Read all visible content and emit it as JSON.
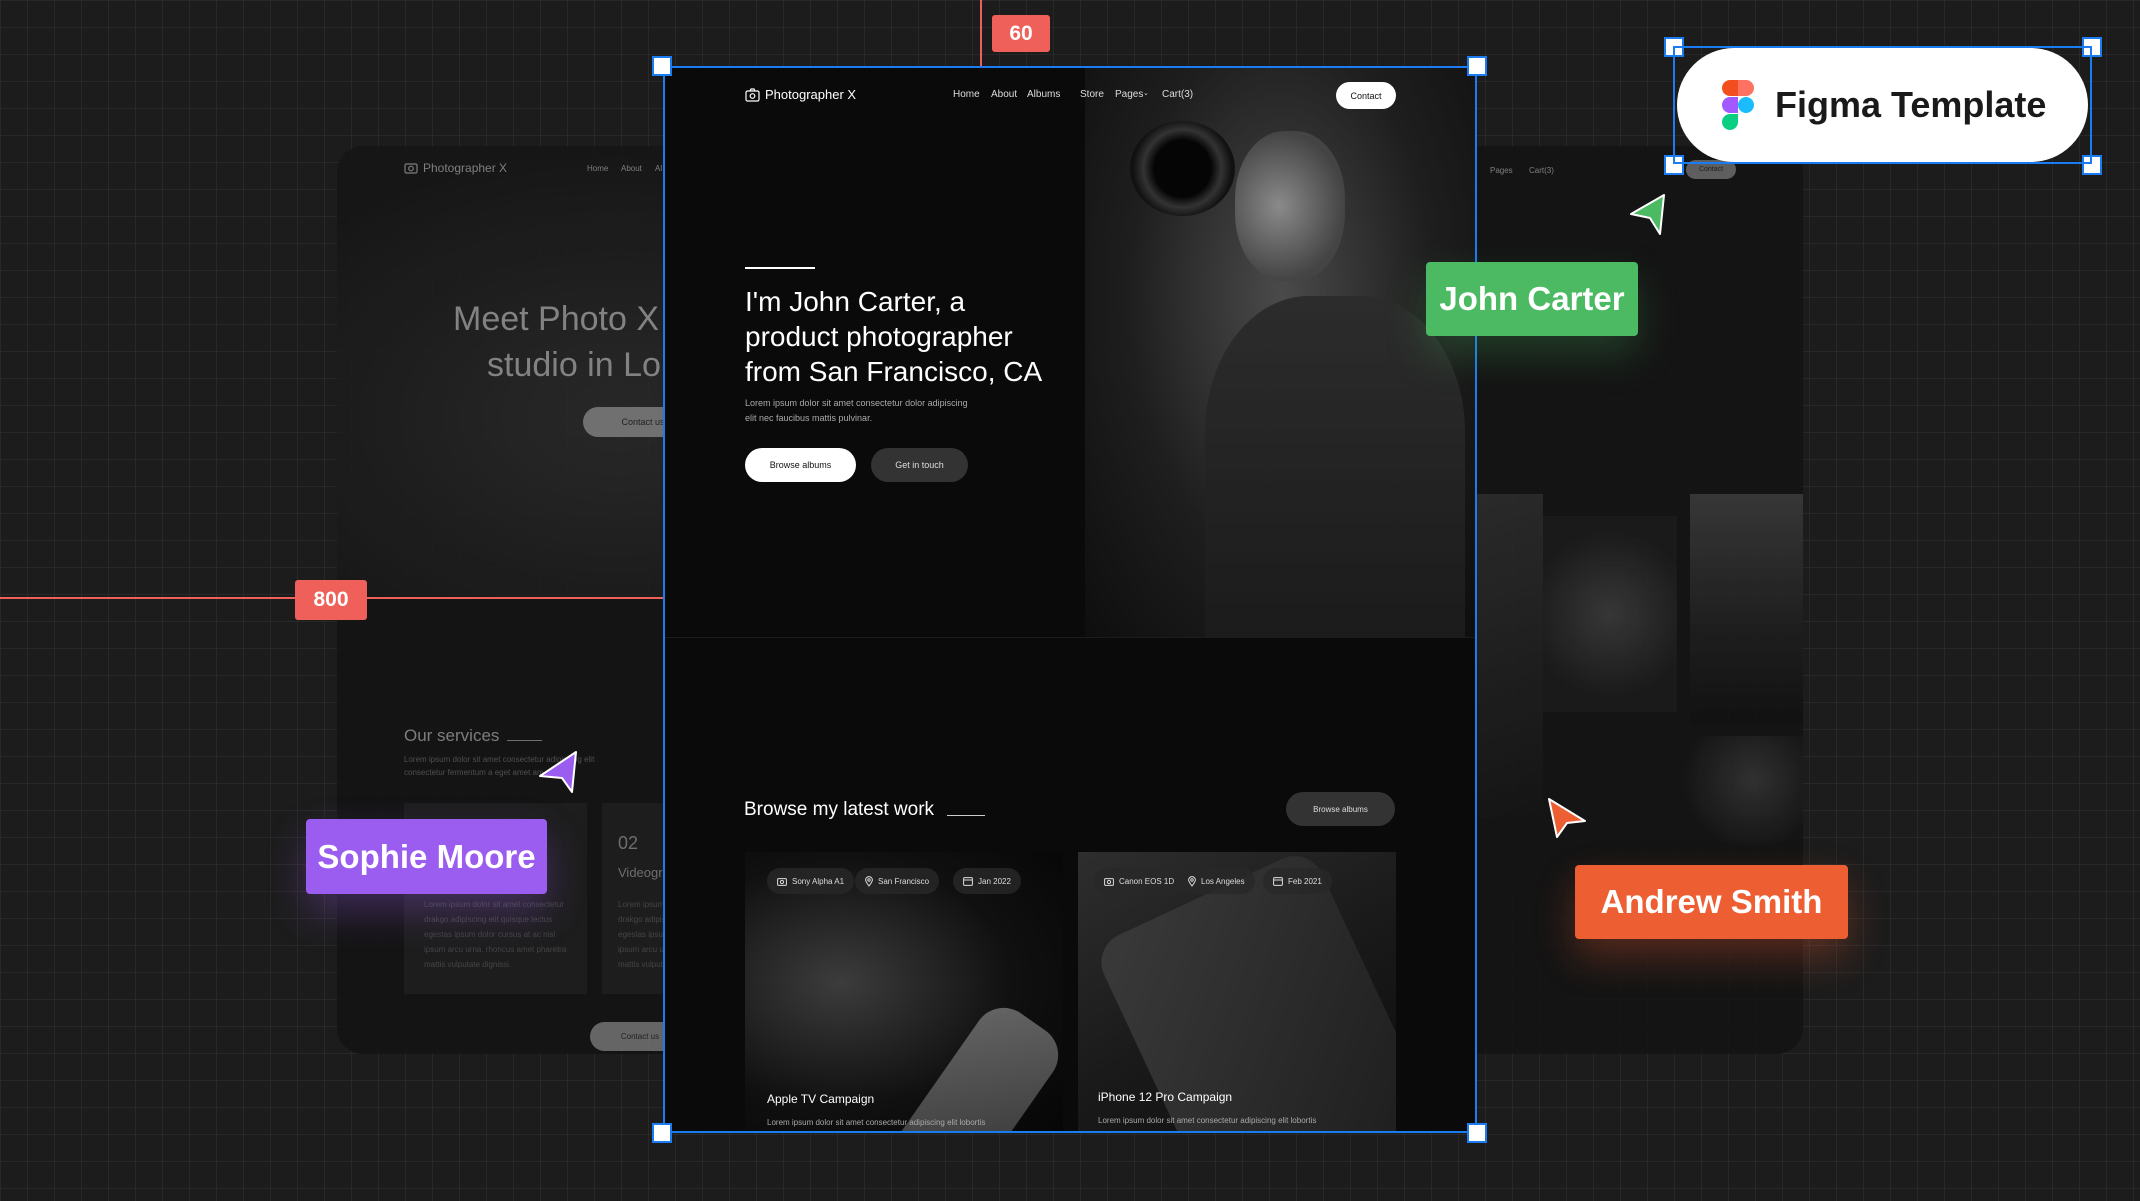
{
  "colors": {
    "selection": "#1a7cf0",
    "ruler": "#f0605a",
    "john": "#4cb963",
    "sophie": "#9b5cf0",
    "andrew": "#ee5e33"
  },
  "rulers": {
    "top": "60",
    "left": "800"
  },
  "badge": {
    "label": "Figma Template",
    "icon": "figma-logo-icon"
  },
  "collaborators": [
    {
      "name": "John Carter"
    },
    {
      "name": "Sophie Moore"
    },
    {
      "name": "Andrew Smith"
    }
  ],
  "left_frame": {
    "brand": "Photographer X",
    "nav": [
      "Home",
      "About",
      "Al"
    ],
    "heading_line1": "Meet Photo X",
    "heading_line2": "studio in Lo",
    "contact": "Contact us",
    "services_title": "Our services",
    "services_text1": "Lorem ipsum dolor sit amet consectetur adipiscing elit",
    "services_text2": "consectetur fermentum a eget amet am",
    "card1_text": [
      "Lorem ipsum dolor sit amet consectetur",
      "drakgo adipiscing elit quisque lectus",
      "egestas ipsum dolor cursus at ac nisl",
      "ipsum arcu urna, rhoncus amet pharetra",
      "mattis vulputate dignissi."
    ],
    "card2_num": "02",
    "card2_title": "Videogra",
    "card2_text": [
      "Lorem ipsum",
      "drakgo adipis",
      "egestas ipsum",
      "ipsum arcu u",
      "mattis vulput"
    ],
    "contact_bottom": "Contact us"
  },
  "right_frame": {
    "nav": [
      "Pages",
      "Cart(3)"
    ],
    "contact": "Contact"
  },
  "main": {
    "brand": "Photographer X",
    "nav": [
      "Home",
      "About",
      "Albums",
      "Store",
      "Pages",
      "Cart(3)"
    ],
    "contact": "Contact",
    "hero": {
      "title": [
        "I'm John Carter, a",
        "product photographer",
        "from San Francisco, CA"
      ],
      "text": [
        "Lorem ipsum dolor sit amet consectetur dolor adipiscing",
        "elit nec faucibus mattis pulvinar."
      ],
      "primary": "Browse albums",
      "secondary": "Get in touch"
    },
    "work": {
      "title": "Browse my latest work",
      "button": "Browse albums",
      "cards": [
        {
          "camera": "Sony Alpha A1",
          "location": "San Francisco",
          "date": "Jan 2022",
          "title": "Apple TV Campaign",
          "text": "Lorem ipsum dolor sit amet consectetur adipiscing elit lobortis"
        },
        {
          "camera": "Canon EOS 1D",
          "location": "Los Angeles",
          "date": "Feb 2021",
          "title": "iPhone 12 Pro Campaign",
          "text": "Lorem ipsum dolor sit amet consectetur adipiscing elit lobortis"
        }
      ]
    }
  }
}
